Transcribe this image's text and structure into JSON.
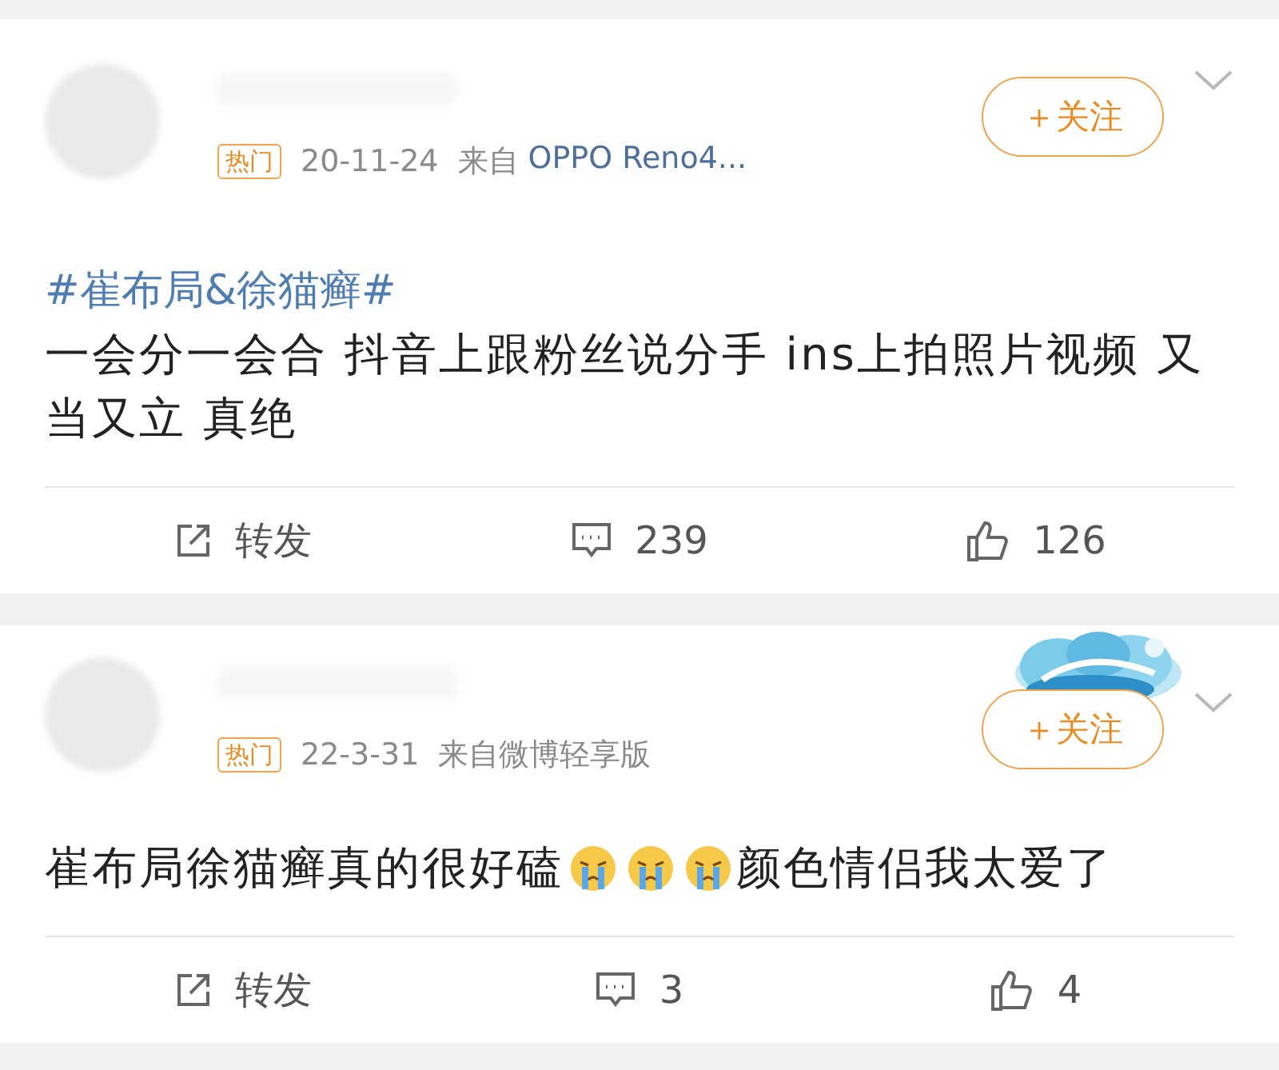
{
  "posts": [
    {
      "badge": "热门",
      "date": "20-11-24",
      "source_prefix": "来自",
      "source": "OPPO Reno4...",
      "source_link": true,
      "follow": "＋关注",
      "decoration": false,
      "hashtag": "#崔布局&徐猫癣#",
      "content": [
        {
          "kind": "text",
          "text": "一会分一会合 抖音上跟粉丝说分手 ins上拍照片视频 又当又立 真绝"
        }
      ],
      "actions": [
        {
          "kind": "forward",
          "label": "转发"
        },
        {
          "kind": "comment",
          "label": "239"
        },
        {
          "kind": "like",
          "label": "126"
        }
      ]
    },
    {
      "badge": "热门",
      "date": "22-3-31",
      "source_prefix": "来自",
      "source": "微博轻享版",
      "source_link": false,
      "follow": "＋关注",
      "decoration": true,
      "content": [
        {
          "kind": "text",
          "text": "崔布局徐猫癣真的很好磕"
        },
        {
          "kind": "emoji"
        },
        {
          "kind": "emoji"
        },
        {
          "kind": "emoji"
        },
        {
          "kind": "text",
          "text": "颜色情侣我太爱了"
        }
      ],
      "actions": [
        {
          "kind": "forward",
          "label": "转发"
        },
        {
          "kind": "comment",
          "label": "3"
        },
        {
          "kind": "like",
          "label": "4"
        }
      ]
    }
  ]
}
